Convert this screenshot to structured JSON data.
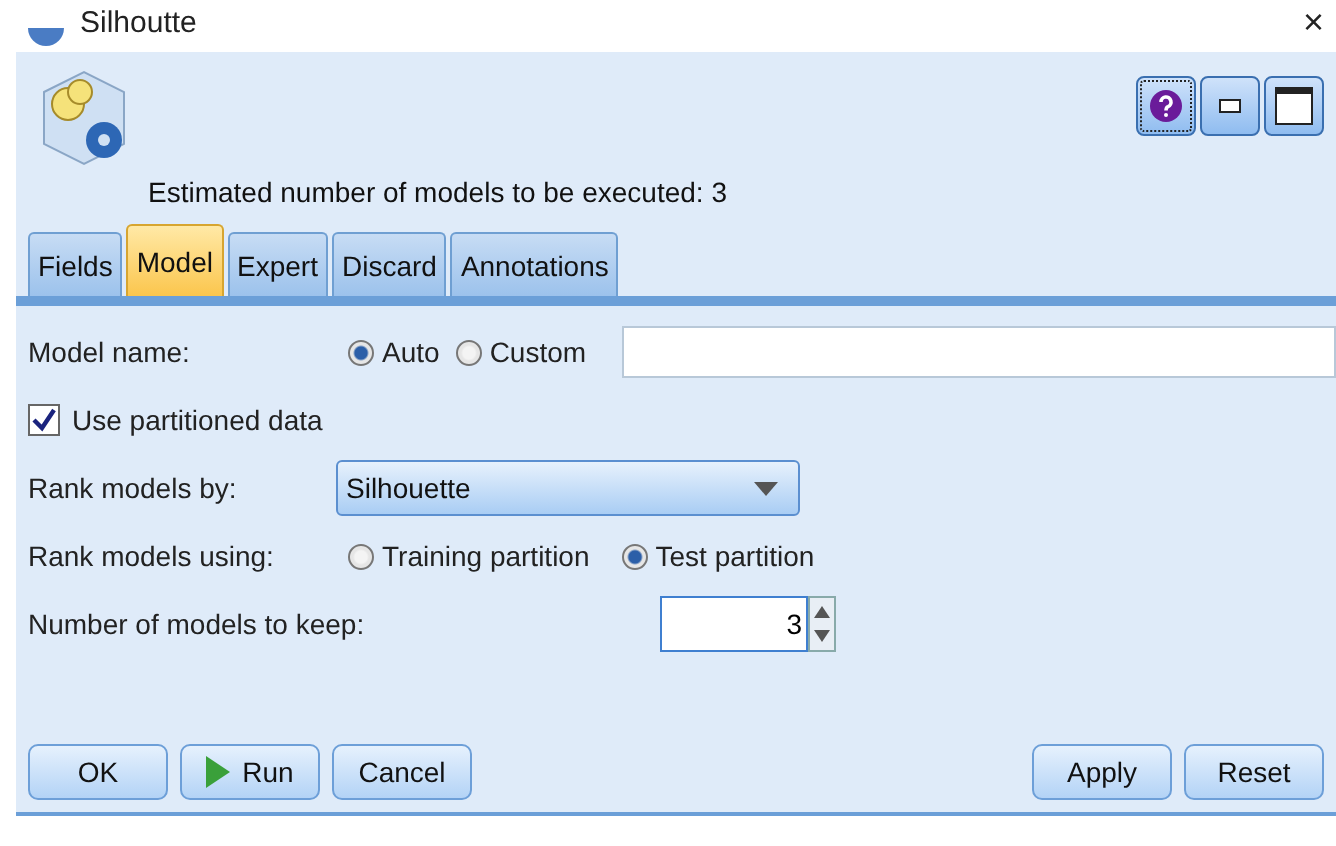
{
  "window": {
    "title": "Silhoutte",
    "close": "×"
  },
  "header": {
    "text": "Estimated number of models to be executed: 3"
  },
  "tabs": [
    {
      "label": "Fields",
      "selected": false
    },
    {
      "label": "Model",
      "selected": true
    },
    {
      "label": "Expert",
      "selected": false
    },
    {
      "label": "Discard",
      "selected": false
    },
    {
      "label": "Annotations",
      "selected": false
    }
  ],
  "model_name": {
    "label": "Model name:",
    "options": [
      {
        "label": "Auto",
        "selected": true
      },
      {
        "label": "Custom",
        "selected": false
      }
    ]
  },
  "partitioned": {
    "label": "Use partitioned data",
    "checked": true
  },
  "rank_by": {
    "label": "Rank models by:",
    "value": "Silhouette"
  },
  "rank_using": {
    "label": "Rank models using:",
    "options": [
      {
        "label": "Training partition",
        "selected": false
      },
      {
        "label": "Test partition",
        "selected": true
      }
    ]
  },
  "keep": {
    "label": "Number of models to keep:",
    "value": "3"
  },
  "buttons_left": [
    {
      "label": "OK",
      "kind": "plain"
    },
    {
      "label": "Run",
      "kind": "run"
    },
    {
      "label": "Cancel",
      "kind": "plain"
    }
  ],
  "buttons_right": [
    {
      "label": "Apply"
    },
    {
      "label": "Reset"
    }
  ]
}
